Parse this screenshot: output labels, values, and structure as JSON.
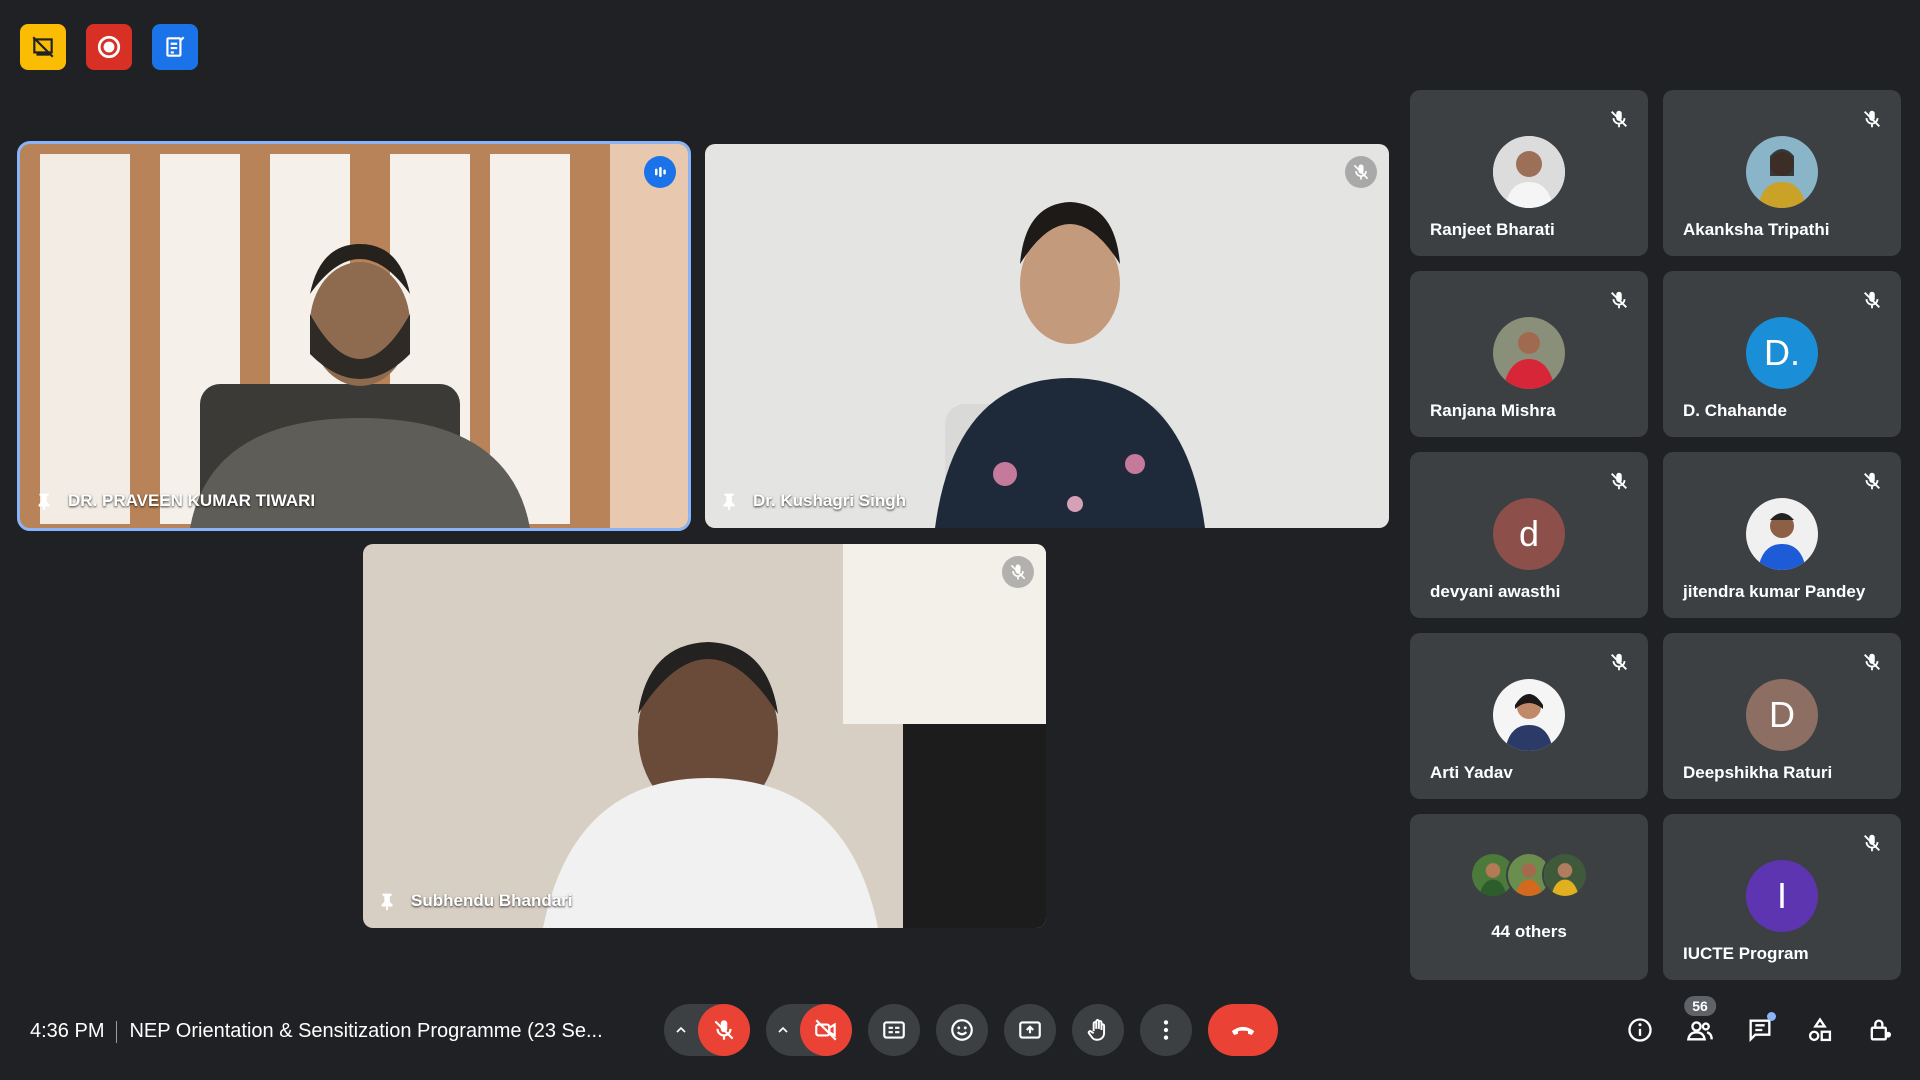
{
  "top_icons": [
    {
      "name": "cast-off-icon",
      "color": "#fbbc04"
    },
    {
      "name": "recording-icon",
      "color": "#d93025"
    },
    {
      "name": "transcript-icon",
      "color": "#1a73e8"
    }
  ],
  "main_tiles": [
    {
      "name": "DR. PRAVEEN KUMAR TIWARI",
      "active": true,
      "status": "speaking"
    },
    {
      "name": "Dr. Kushagri Singh",
      "status": "muted"
    },
    {
      "name": "Subhendu Bhandari",
      "status": "muted"
    }
  ],
  "side_tiles": [
    {
      "name": "Ranjeet Bharati",
      "avatar": "photo",
      "muted": true
    },
    {
      "name": "Akanksha Tripathi",
      "avatar": "photo",
      "muted": true
    },
    {
      "name": "Ranjana Mishra",
      "avatar": "photo",
      "muted": true
    },
    {
      "name": "D. Chahande",
      "avatar": "letter",
      "letter": "D.",
      "color": "#1a8fd8",
      "muted": true
    },
    {
      "name": "devyani awasthi",
      "avatar": "letter",
      "letter": "d",
      "color": "#8d4f4a",
      "muted": true
    },
    {
      "name": "jitendra kumar Pandey",
      "avatar": "photo",
      "muted": true
    },
    {
      "name": "Arti Yadav",
      "avatar": "photo",
      "muted": true
    },
    {
      "name": "Deepshikha Raturi",
      "avatar": "letter",
      "letter": "D",
      "color": "#8d6e63",
      "muted": true
    },
    {
      "name": "44 others",
      "avatar": "group",
      "muted": false
    },
    {
      "name": "IUCTE Program",
      "avatar": "letter",
      "letter": "I",
      "color": "#5e35b1",
      "muted": true
    }
  ],
  "bottom": {
    "time": "4:36 PM",
    "meeting_title": "NEP Orientation & Sensitization Programme (23 Se...",
    "people_count": "56",
    "colors": {
      "end_call": "#ea4335",
      "mic_off": "#ea4335"
    }
  }
}
